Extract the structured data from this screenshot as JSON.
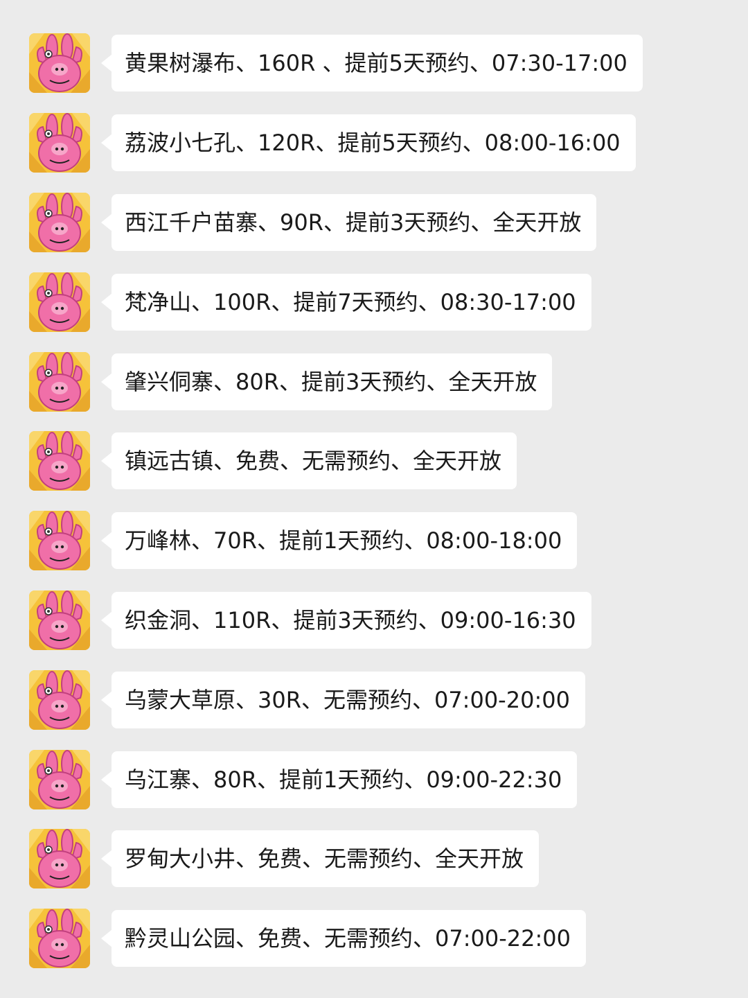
{
  "colors": {
    "background": "#ebebeb",
    "bubble": "#ffffff",
    "text": "#1a1a1a",
    "avatar_pink": "#f06fa8",
    "avatar_yellow": "#f6c23a"
  },
  "avatar_icon": "pink-bunny-avatar",
  "messages": [
    {
      "text": "黄果树瀑布、160R 、提前5天预约、07:30-17:00"
    },
    {
      "text": "荔波小七孔、120R、提前5天预约、08:00-16:00"
    },
    {
      "text": "西江千户苗寨、90R、提前3天预约、全天开放"
    },
    {
      "text": "梵净山、100R、提前7天预约、08:30-17:00"
    },
    {
      "text": "肇兴侗寨、80R、提前3天预约、全天开放"
    },
    {
      "text": "镇远古镇、免费、无需预约、全天开放"
    },
    {
      "text": "万峰林、70R、提前1天预约、08:00-18:00"
    },
    {
      "text": "织金洞、110R、提前3天预约、09:00-16:30"
    },
    {
      "text": "乌蒙大草原、30R、无需预约、07:00-20:00"
    },
    {
      "text": "乌江寨、80R、提前1天预约、09:00-22:30"
    },
    {
      "text": "罗甸大小井、免费、无需预约、全天开放"
    },
    {
      "text": "黔灵山公园、免费、无需预约、07:00-22:00"
    }
  ]
}
